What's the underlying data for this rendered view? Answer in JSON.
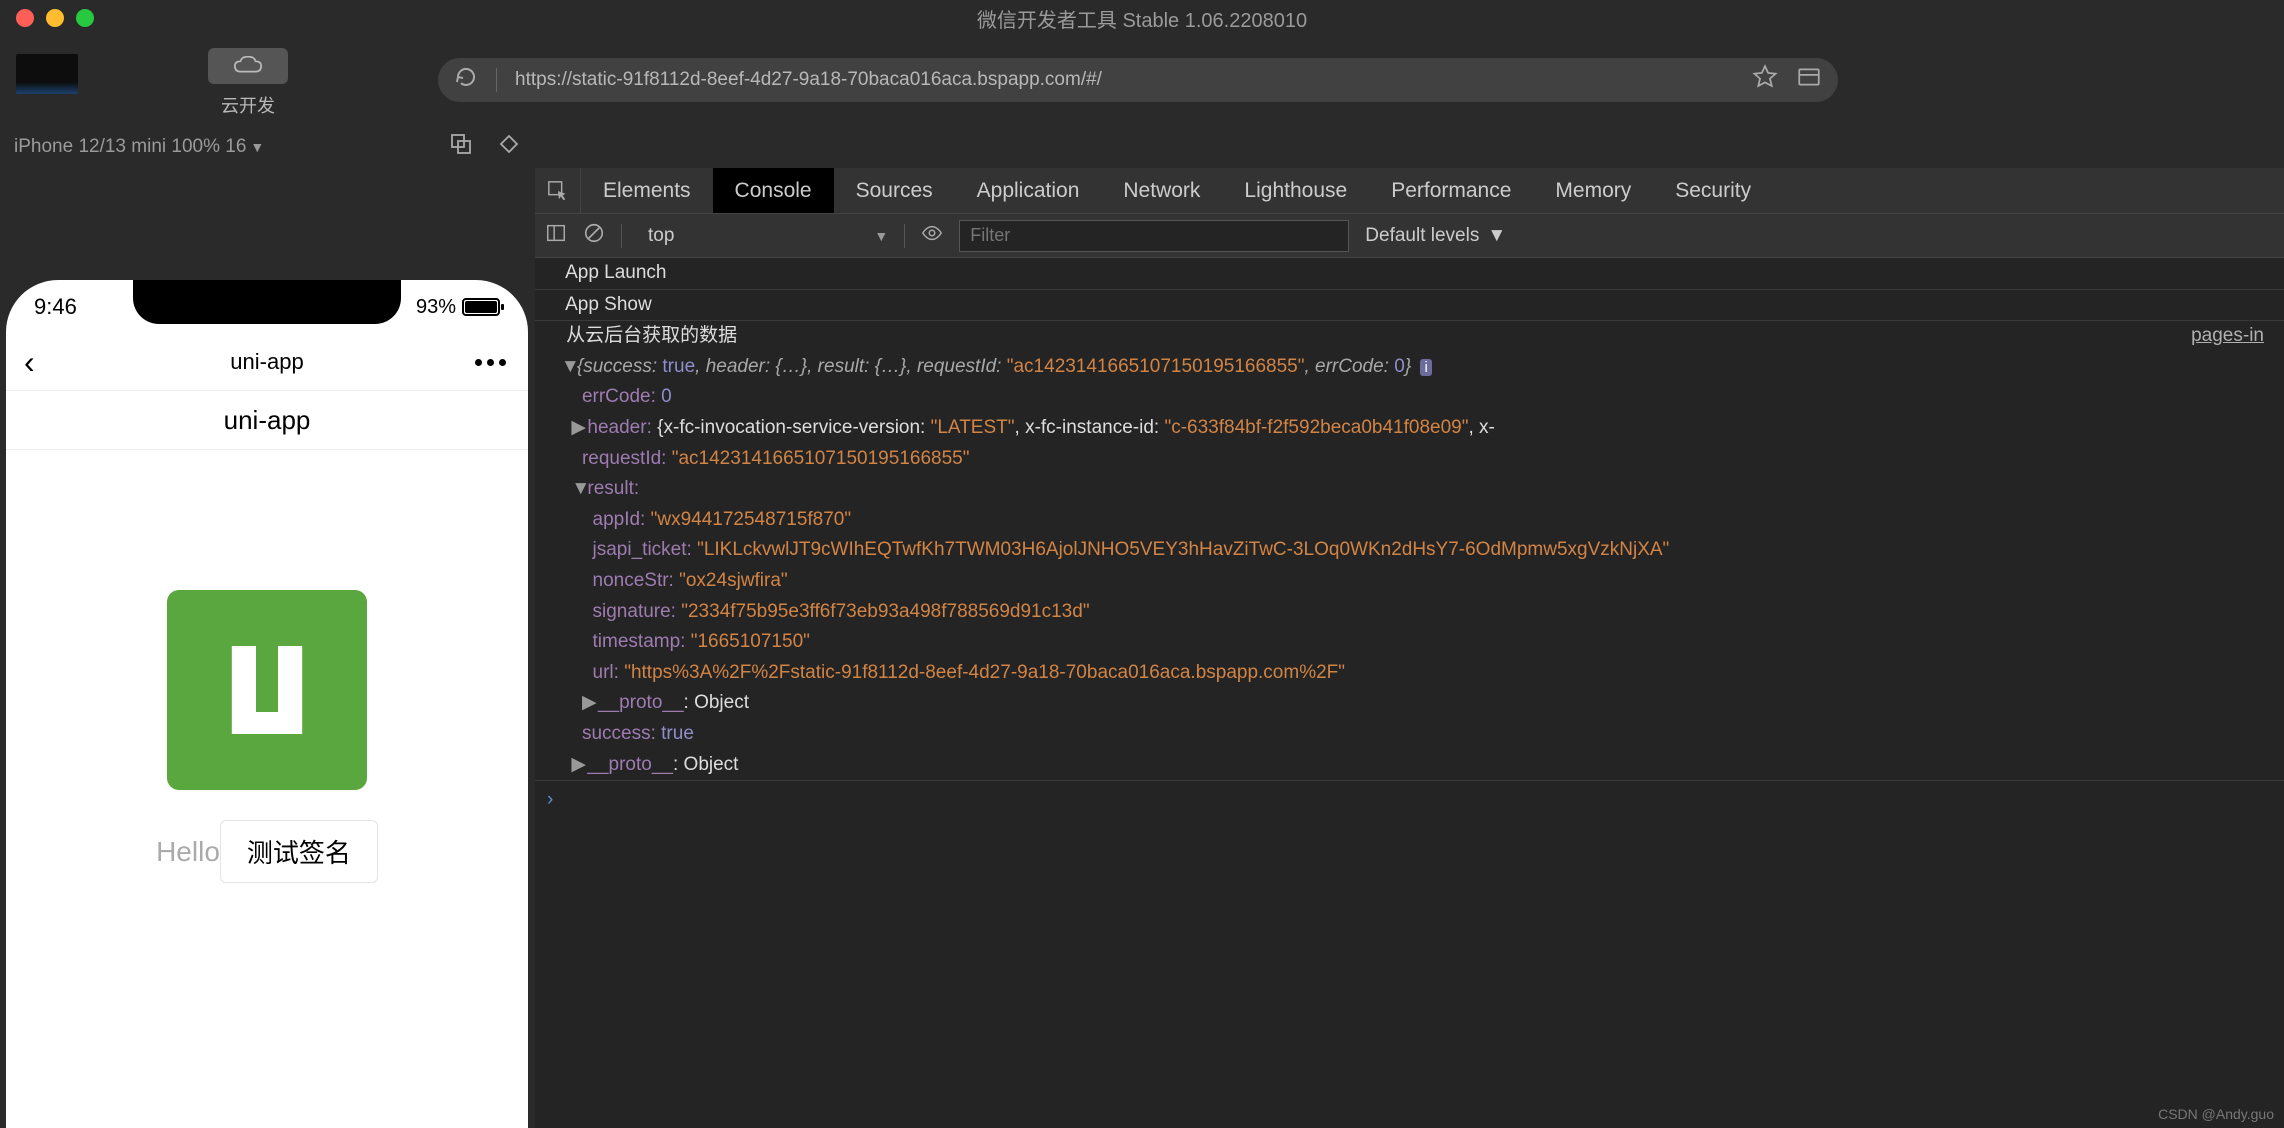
{
  "window": {
    "title": "微信开发者工具 Stable 1.06.2208010"
  },
  "toolbar": {
    "cloud_label": "云开发",
    "url": "https://static-91f8112d-8eef-4d27-9a18-70baca016aca.bspapp.com/#/"
  },
  "device": {
    "label": "iPhone 12/13 mini 100% 16"
  },
  "devtools": {
    "tabs": [
      "Elements",
      "Console",
      "Sources",
      "Application",
      "Network",
      "Lighthouse",
      "Performance",
      "Memory",
      "Security"
    ],
    "active_tab": "Console",
    "context": "top",
    "filter_placeholder": "Filter",
    "levels_label": "Default levels"
  },
  "console": {
    "line1": "App Launch",
    "line2": "App Show",
    "line3": "从云后台获取的数据",
    "source_link": "pages-in",
    "summary_prefix": "{success: ",
    "summary_true": "true",
    "summary_mid1": ", header: ",
    "summary_obj1": "{…}",
    "summary_mid2": ", result: ",
    "summary_obj2": "{…}",
    "summary_mid3": ", requestId: ",
    "summary_reqid": "\"ac1423141665107150195166855\"",
    "summary_mid4": ", errCode: ",
    "summary_errcode": "0",
    "summary_suffix": "}",
    "badge": "i",
    "errCode_k": "errCode:",
    "errCode_v": "0",
    "header_k": "header:",
    "header_v1": "{x-fc-invocation-service-version: ",
    "header_latest": "\"LATEST\"",
    "header_v2": ", x-fc-instance-id: ",
    "header_inst": "\"c-633f84bf-f2f592beca0b41f08e09\"",
    "header_v3": ", x-",
    "requestId_k": "requestId:",
    "requestId_v": "\"ac1423141665107150195166855\"",
    "result_k": "result:",
    "appId_k": "appId:",
    "appId_v": "\"wx944172548715f870\"",
    "jsapi_k": "jsapi_ticket:",
    "jsapi_v": "\"LIKLckvwlJT9cWIhEQTwfKh7TWM03H6AjolJNHO5VEY3hHavZiTwC-3LOq0WKn2dHsY7-6OdMpmw5xgVzkNjXA\"",
    "nonceStr_k": "nonceStr:",
    "nonceStr_v": "\"ox24sjwfira\"",
    "signature_k": "signature:",
    "signature_v": "\"2334f75b95e3ff6f73eb93a498f788569d91c13d\"",
    "timestamp_k": "timestamp:",
    "timestamp_v": "\"1665107150\"",
    "url_k": "url:",
    "url_v": "\"https%3A%2F%2Fstatic-91f8112d-8eef-4d27-9a18-70baca016aca.bspapp.com%2F\"",
    "proto_k": "__proto__",
    "proto_v": ": Object",
    "success_k": "success:",
    "success_v": "true"
  },
  "sim": {
    "time": "9:46",
    "battery": "93%",
    "nav_title": "uni-app",
    "section_title": "uni-app",
    "hello": "Hello",
    "button": "测试签名"
  },
  "watermark": "CSDN @Andy.guo"
}
